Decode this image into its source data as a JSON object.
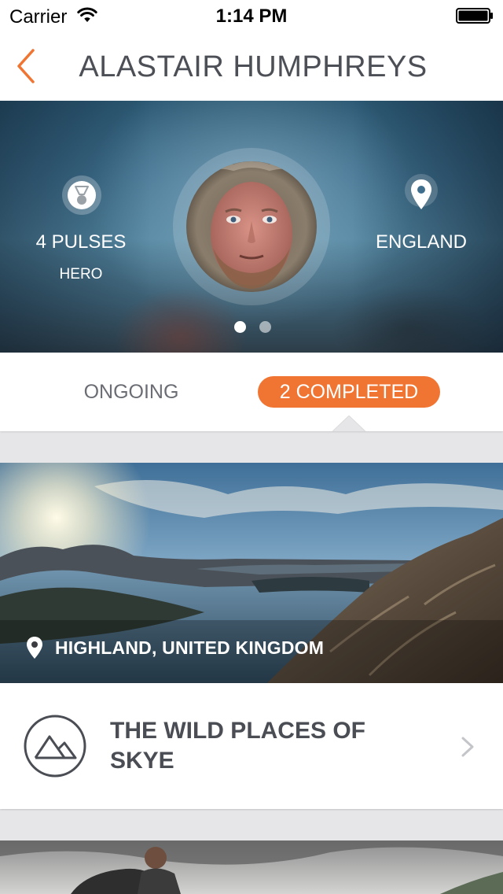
{
  "status_bar": {
    "carrier": "Carrier",
    "time": "1:14 PM"
  },
  "nav": {
    "title": "ALASTAIR HUMPHREYS",
    "back_icon": "chevron-left-icon"
  },
  "profile": {
    "pulses": "4 PULSES",
    "rank": "HERO",
    "location": "ENGLAND",
    "page_dots": {
      "count": 2,
      "active": 1
    }
  },
  "tabs": {
    "ongoing_label": "ONGOING",
    "completed_label": "2 COMPLETED",
    "active": "completed"
  },
  "cards": [
    {
      "location": "HIGHLAND, UNITED KINGDOM",
      "title": "THE WILD PLACES OF SKYE"
    }
  ],
  "colors": {
    "accent": "#f07532",
    "title_text": "#4d4f57",
    "tab_text": "#6b6d74",
    "background": "#e6e6e8"
  }
}
